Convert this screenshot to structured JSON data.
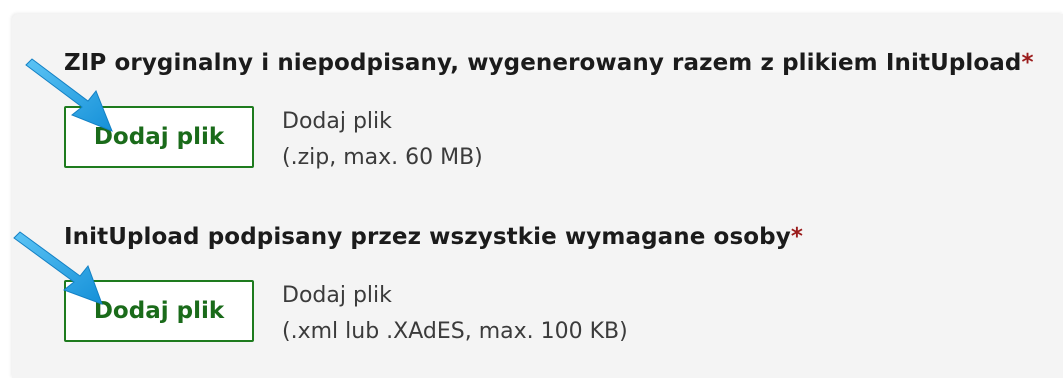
{
  "fields": [
    {
      "label": "ZIP oryginalny i niepodpisany, wygenerowany razem z plikiem InitUpload",
      "required_mark": "*",
      "button_label": "Dodaj plik",
      "hint_title": "Dodaj plik",
      "hint_detail": "(.zip, max. 60 MB)"
    },
    {
      "label": "InitUpload podpisany przez wszystkie wymagane osoby",
      "required_mark": "*",
      "button_label": "Dodaj plik",
      "hint_title": "Dodaj plik",
      "hint_detail": "(.xml lub .XAdES, max. 100 KB)"
    }
  ],
  "annotation": {
    "arrow_icon": "pointer-arrow-icon",
    "arrow_color": "#1fa3e6"
  },
  "colors": {
    "button_border": "#1e7b1e",
    "button_text": "#1a6b1a",
    "required": "#9b1c1c",
    "panel_bg": "#f4f4f4"
  }
}
